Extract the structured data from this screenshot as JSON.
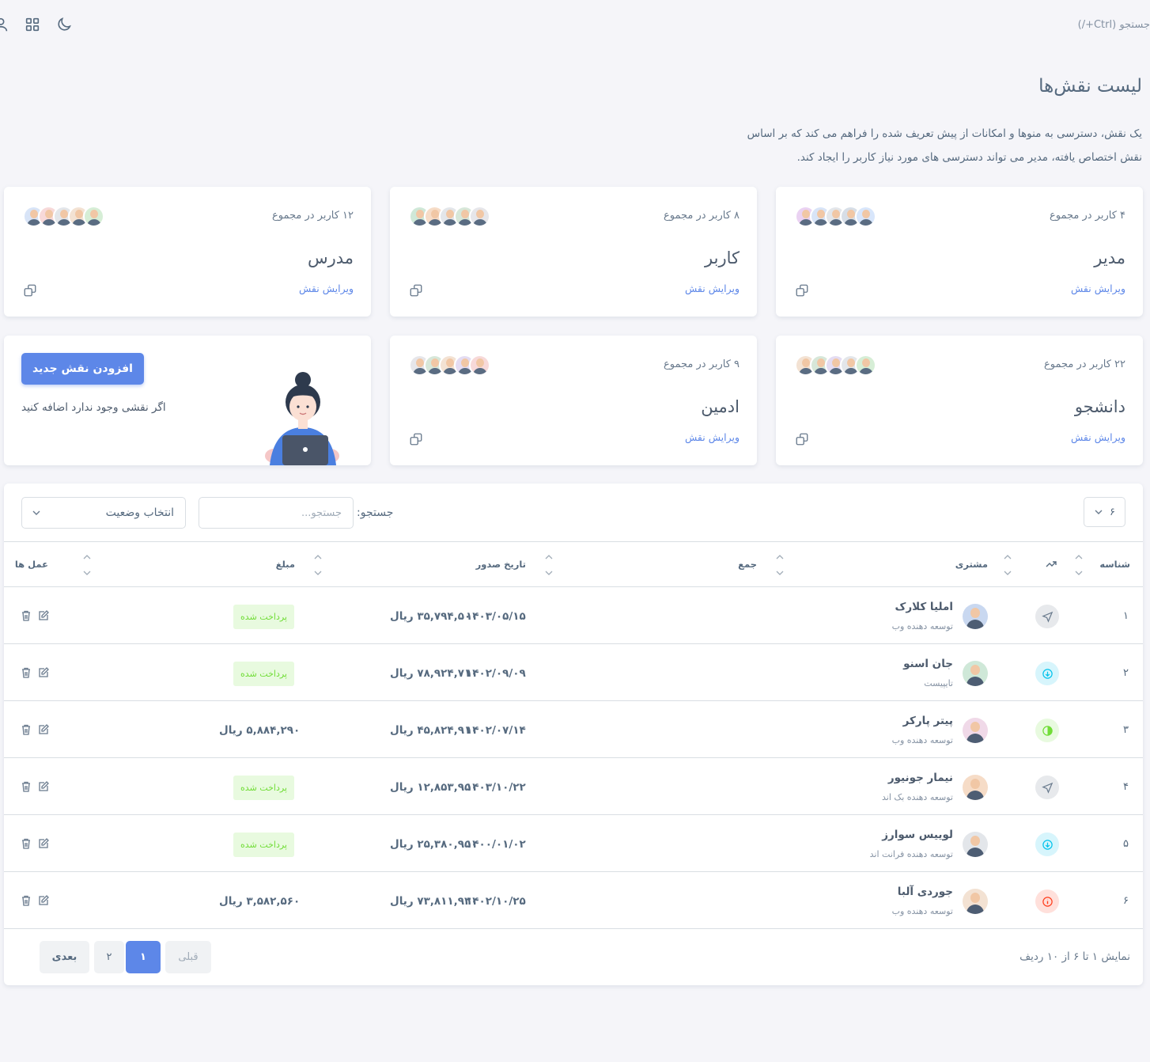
{
  "nav": {
    "search_hint": "جستجو (Ctrl+/)",
    "icons": [
      "user-icon",
      "grid-icon",
      "moon-icon"
    ]
  },
  "page": {
    "title": "لیست نقش‌ها",
    "description": "یک نقش، دسترسی به منوها و امکانات از پیش تعریف شده را فراهم می کند که بر اساس نقش اختصاص یافته، مدیر می تواند دسترسی های مورد نیاز کاربر را ایجاد کند."
  },
  "roles": [
    {
      "count": "۴ کاربر در مجموع",
      "name": "مدیر",
      "edit": "ویرایش نقش"
    },
    {
      "count": "۸ کاربر در مجموع",
      "name": "کاربر",
      "edit": "ویرایش نقش"
    },
    {
      "count": "۱۲ کاربر در مجموع",
      "name": "مدرس",
      "edit": "ویرایش نقش"
    },
    {
      "count": "۲۲ کاربر در مجموع",
      "name": "دانشجو",
      "edit": "ویرایش نقش"
    },
    {
      "count": "۹ کاربر در مجموع",
      "name": "ادمین",
      "edit": "ویرایش نقش"
    }
  ],
  "add_role": {
    "button": "افزودن نقش جدید",
    "hint": "اگر نقشی وجود ندارد اضافه کنید"
  },
  "table": {
    "length_value": "۶",
    "search_label": "جستجو:",
    "search_placeholder": "جستجو...",
    "status_select": "انتخاب وضعیت",
    "headers": {
      "id": "شناسه",
      "customer": "مشتری",
      "total": "جمع",
      "date": "تاریخ صدور",
      "amount": "مبلغ",
      "actions": "عمل ها"
    },
    "rows": [
      {
        "id": "۱",
        "trend_icon": "send-icon",
        "name": "املیا کلارک",
        "role": "توسعه دهنده وب",
        "total": "۳۵,۷۹۴,۵۰۰ ریال",
        "date": "۱۴۰۳/۰۵/۱۵",
        "status": "پرداخت شده",
        "amount": ""
      },
      {
        "id": "۲",
        "trend_icon": "arrow-down-circle-icon",
        "name": "جان اسنو",
        "role": "تایپیست",
        "total": "۷۸,۹۲۴,۷۱۰ ریال",
        "date": "۱۴۰۲/۰۹/۰۹",
        "status": "پرداخت شده",
        "amount": ""
      },
      {
        "id": "۳",
        "trend_icon": "half-circle-icon",
        "name": "پیتر پارکر",
        "role": "توسعه دهنده وب",
        "total": "۴۵,۸۲۴,۹۱۰ ریال",
        "date": "۱۴۰۲/۰۷/۱۴",
        "status": "",
        "amount": "۵,۸۸۴,۲۹۰ ریال"
      },
      {
        "id": "۴",
        "trend_icon": "send-icon",
        "name": "نیمار جونیور",
        "role": "توسعه دهنده بک اند",
        "total": "۱۲,۸۵۳,۹۵۰ ریال",
        "date": "۱۴۰۳/۱۰/۲۲",
        "status": "پرداخت شده",
        "amount": ""
      },
      {
        "id": "۵",
        "trend_icon": "arrow-down-circle-icon",
        "name": "لوییس سوارز",
        "role": "توسعه دهنده فرانت اند",
        "total": "۲۵,۳۸۰,۹۵۰ ریال",
        "date": "۱۴۰۰/۰۱/۰۲",
        "status": "پرداخت شده",
        "amount": ""
      },
      {
        "id": "۶",
        "trend_icon": "info-icon",
        "name": "جوردی آلبا",
        "role": "توسعه دهنده وب",
        "total": "۷۳,۸۱۱,۹۳۰ ریال",
        "date": "۱۴۰۲/۱۰/۲۵",
        "status": "",
        "amount": "۳,۵۸۲,۵۶۰ ریال"
      }
    ],
    "footer_info": "نمایش ۱ تا ۶ از ۱۰ ردیف",
    "pagination": {
      "next": "بعدی",
      "page2": "۲",
      "page1": "۱",
      "prev": "قبلی"
    }
  },
  "colors": {
    "primary": "#5d87e8",
    "success_bg": "#e8fadf",
    "success_text": "#71dd37",
    "info": "#03c3ec",
    "danger": "#ff3e1d"
  }
}
